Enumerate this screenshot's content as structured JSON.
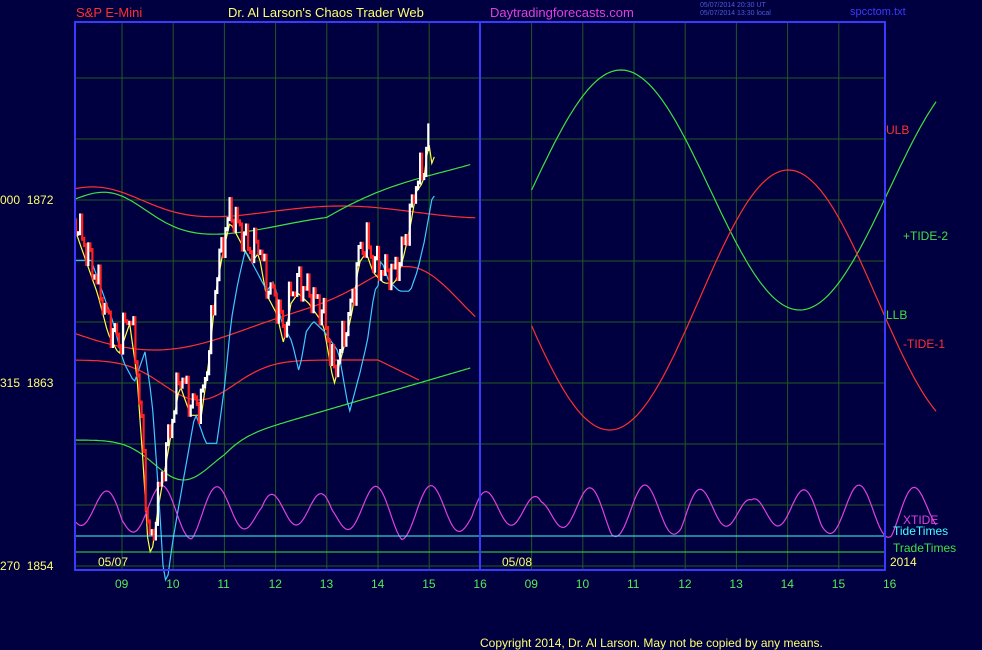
{
  "header": {
    "symbol": "S&P E-Mini",
    "title": "Dr. Al Larson's Chaos Trader Web",
    "site": "Daytradingforecasts.com",
    "stamp1": "05/07/2014 20:30 UT",
    "stamp2": "05/07/2014 13:30 local",
    "file": "spcctom.txt"
  },
  "colors": {
    "background": "#000040",
    "frame": "#3a3aff",
    "grid": "#205a20",
    "price_up": "#ffffff",
    "price_down": "#ff2020",
    "bands_red": "#ff3030",
    "bands_green": "#40e040",
    "ma_yellow": "#ffff40",
    "ma_cyan": "#40c8ff",
    "xtide": "#e040e0",
    "tidetimes": "#40ffff",
    "tradetimes": "#40e040"
  },
  "chart_data": {
    "type": "line",
    "title": "S&P E-Mini",
    "y_axis_labels": [
      {
        "left": "000",
        "value": 1872
      },
      {
        "left": "315",
        "value": 1863
      },
      {
        "left": "270",
        "value": 1854
      }
    ],
    "ylim": [
      1854,
      1872
    ],
    "x_hour_labels": [
      "09",
      "10",
      "11",
      "12",
      "13",
      "14",
      "15",
      "16",
      "09",
      "10",
      "11",
      "12",
      "13",
      "14",
      "15",
      "16"
    ],
    "date_labels": [
      "05/07",
      "05/08",
      "2014"
    ],
    "right_labels": [
      {
        "text": "ULB",
        "color": "#ff3030"
      },
      {
        "text": "+TIDE-2",
        "color": "#40e040"
      },
      {
        "text": "LLB",
        "color": "#40e040"
      },
      {
        "text": "-TIDE-1",
        "color": "#ff3030"
      },
      {
        "text": "XTIDE",
        "color": "#e040e0"
      },
      {
        "text": "TideTimes",
        "color": "#40ffff"
      },
      {
        "text": "TradeTimes",
        "color": "#40e040"
      }
    ],
    "price_path": [
      [
        0,
        1871.0
      ],
      [
        0.15,
        1869.5
      ],
      [
        0.3,
        1868.0
      ],
      [
        0.45,
        1866.0
      ],
      [
        0.6,
        1865.0
      ],
      [
        0.75,
        1866.5
      ],
      [
        0.85,
        1864.0
      ],
      [
        0.95,
        1859.0
      ],
      [
        1.0,
        1856.0
      ],
      [
        1.05,
        1855.0
      ],
      [
        1.15,
        1857.5
      ],
      [
        1.3,
        1860.5
      ],
      [
        1.45,
        1863.5
      ],
      [
        1.6,
        1862.0
      ],
      [
        1.75,
        1862.0
      ],
      [
        1.85,
        1864.5
      ],
      [
        1.95,
        1868.0
      ],
      [
        2.05,
        1870.0
      ],
      [
        2.15,
        1871.5
      ],
      [
        2.3,
        1870.5
      ],
      [
        2.45,
        1869.5
      ],
      [
        2.55,
        1870.0
      ],
      [
        2.65,
        1868.0
      ],
      [
        2.8,
        1867.0
      ],
      [
        2.9,
        1865.5
      ],
      [
        3.0,
        1867.5
      ],
      [
        3.1,
        1868.0
      ],
      [
        3.25,
        1867.5
      ],
      [
        3.35,
        1867.0
      ],
      [
        3.45,
        1866.5
      ],
      [
        3.6,
        1863.5
      ],
      [
        3.75,
        1865.5
      ],
      [
        3.85,
        1867.0
      ],
      [
        3.95,
        1869.5
      ],
      [
        4.05,
        1870.0
      ],
      [
        4.15,
        1869.0
      ],
      [
        4.3,
        1868.5
      ],
      [
        4.45,
        1868.5
      ],
      [
        4.55,
        1869.5
      ],
      [
        4.65,
        1871.0
      ],
      [
        4.75,
        1873.0
      ],
      [
        4.85,
        1873.5
      ],
      [
        4.92,
        1875.5
      ],
      [
        4.98,
        1874.0
      ],
      [
        5.05,
        1876.5
      ],
      [
        5.12,
        1875.0
      ]
    ],
    "series": [
      {
        "name": "ULB",
        "color": "#ff3030"
      },
      {
        "name": "+TIDE-2",
        "color": "#40e040"
      },
      {
        "name": "LLB",
        "color": "#40e040"
      },
      {
        "name": "-TIDE-1",
        "color": "#ff3030"
      },
      {
        "name": "XTIDE",
        "color": "#e040e0"
      },
      {
        "name": "TideTimes",
        "color": "#40ffff"
      },
      {
        "name": "TradeTimes",
        "color": "#40e040"
      }
    ]
  },
  "copyright": "Copyright 2014, Dr. Al Larson. May not be copied by any means."
}
